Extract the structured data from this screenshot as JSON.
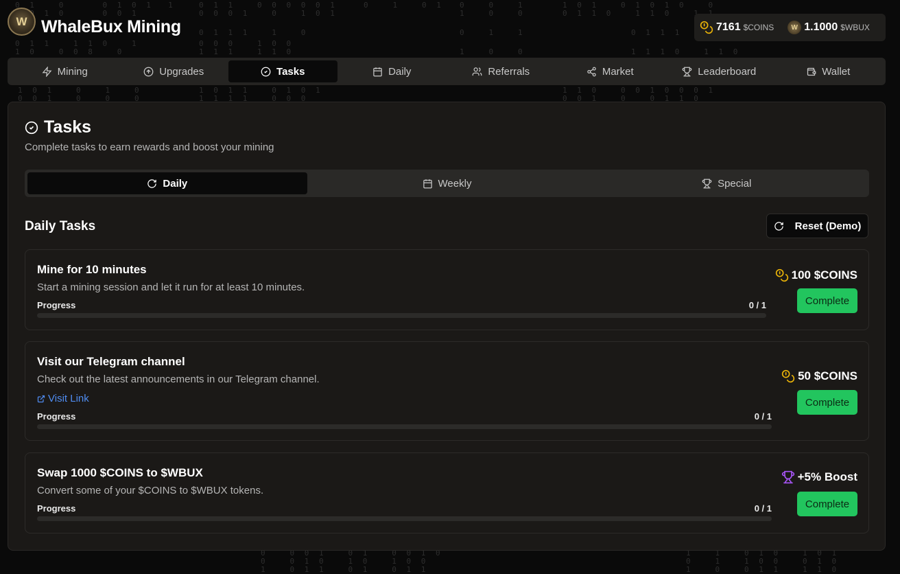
{
  "app": {
    "title": "WhaleBux Mining",
    "logo_icon": "whale-coin-logo"
  },
  "balances": [
    {
      "amount": "7161",
      "unit": "$COINS",
      "icon": "coins-icon"
    },
    {
      "amount": "1.1000",
      "unit": "$WBUX",
      "icon": "wbux-coin-icon"
    }
  ],
  "nav": [
    {
      "label": "Mining",
      "icon": "zap-icon",
      "active": false
    },
    {
      "label": "Upgrades",
      "icon": "arrow-up-circle-icon",
      "active": false
    },
    {
      "label": "Tasks",
      "icon": "check-circle-icon",
      "active": true
    },
    {
      "label": "Daily",
      "icon": "calendar-icon",
      "active": false
    },
    {
      "label": "Referrals",
      "icon": "users-icon",
      "active": false
    },
    {
      "label": "Market",
      "icon": "share-icon",
      "active": false
    },
    {
      "label": "Leaderboard",
      "icon": "trophy-icon",
      "active": false
    },
    {
      "label": "Wallet",
      "icon": "wallet-icon",
      "active": false
    }
  ],
  "page": {
    "title": "Tasks",
    "subtitle": "Complete tasks to earn rewards and boost your mining"
  },
  "task_tabs": [
    {
      "label": "Daily",
      "icon": "refresh-icon",
      "active": true
    },
    {
      "label": "Weekly",
      "icon": "calendar-icon",
      "active": false
    },
    {
      "label": "Special",
      "icon": "trophy-icon",
      "active": false
    }
  ],
  "section": {
    "title": "Daily Tasks",
    "reset_label": "Reset (Demo)"
  },
  "tasks": [
    {
      "title": "Mine for 10 minutes",
      "description": "Start a mining session and let it run for at least 10 minutes.",
      "link": "",
      "progress_label": "Progress",
      "progress_count": "0 / 1",
      "progress_fraction": 0,
      "reward": "100 $COINS",
      "reward_icon": "coins-icon",
      "reward_color": "#eab308",
      "button": "Complete"
    },
    {
      "title": "Visit our Telegram channel",
      "description": "Check out the latest announcements in our Telegram channel.",
      "link": "Visit Link",
      "progress_label": "Progress",
      "progress_count": "0 / 1",
      "progress_fraction": 0,
      "reward": "50 $COINS",
      "reward_icon": "coins-icon",
      "reward_color": "#eab308",
      "button": "Complete"
    },
    {
      "title": "Swap 1000 $COINS to $WBUX",
      "description": "Convert some of your $COINS to $WBUX tokens.",
      "link": "",
      "progress_label": "Progress",
      "progress_count": "0 / 1",
      "progress_fraction": 0,
      "reward": "+5% Boost",
      "reward_icon": "trophy-icon",
      "reward_color": "#a855f7",
      "button": "Complete"
    }
  ],
  "colors": {
    "accent_green": "#22c55e",
    "coin_gold": "#eab308",
    "boost_purple": "#a855f7",
    "link_blue": "#4f8cf0"
  }
}
